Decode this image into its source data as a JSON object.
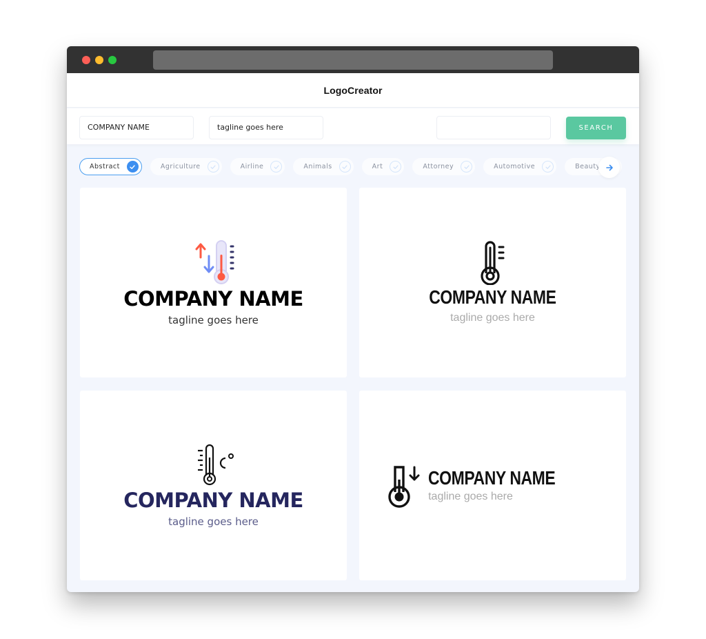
{
  "app": {
    "title": "LogoCreator"
  },
  "search": {
    "company_value": "COMPANY NAME",
    "tagline_value": "tagline goes here",
    "query_value": "",
    "button_label": "SEARCH"
  },
  "categories": [
    {
      "label": "Abstract",
      "selected": true
    },
    {
      "label": "Agriculture",
      "selected": false
    },
    {
      "label": "Airline",
      "selected": false
    },
    {
      "label": "Animals",
      "selected": false
    },
    {
      "label": "Art",
      "selected": false
    },
    {
      "label": "Attorney",
      "selected": false
    },
    {
      "label": "Automotive",
      "selected": false
    },
    {
      "label": "Beauty",
      "selected": false
    }
  ],
  "colors": {
    "accent_green": "#5ac8a0",
    "accent_blue": "#3d8ff0",
    "navy": "#25265e",
    "thermo_red": "#fd5a43",
    "thermo_blue": "#6f8df5"
  },
  "logos": [
    {
      "icon": "thermometer-arrows-icon",
      "company": "COMPANY NAME",
      "tagline": "tagline goes here",
      "company_color": "#000000",
      "tagline_color": "#333333"
    },
    {
      "icon": "thermometer-outline-icon",
      "company": "COMPANY NAME",
      "tagline": "tagline goes here",
      "company_color": "#111111",
      "tagline_color": "#aaaaaa"
    },
    {
      "icon": "thermometer-celsius-icon",
      "company": "COMPANY NAME",
      "tagline": "tagline goes here",
      "company_color": "#25265e",
      "tagline_color": "#5a5c8a"
    },
    {
      "icon": "thermometer-down-icon",
      "company": "COMPANY NAME",
      "tagline": "tagline goes here",
      "company_color": "#111111",
      "tagline_color": "#aaaaaa"
    }
  ]
}
